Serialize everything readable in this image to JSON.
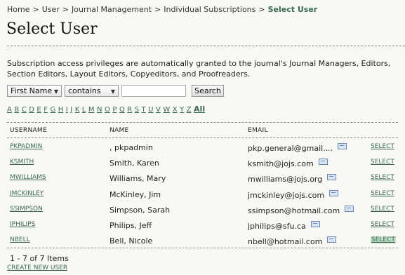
{
  "breadcrumb": {
    "home": "Home",
    "user": "User",
    "journal_management": "Journal Management",
    "individual_subscriptions": "Individual Subscriptions",
    "current": "Select User",
    "separator": ">"
  },
  "page_title": "Select User",
  "intro": "Subscription access privileges are automatically granted to the journal's Journal Managers, Editors, Section Editors, Layout Editors, Copyeditors, and Proofreaders.",
  "search": {
    "field_select": "First Name",
    "match_select": "contains",
    "query_value": "",
    "button": "Search"
  },
  "alphabet": [
    "A",
    "B",
    "C",
    "D",
    "E",
    "F",
    "G",
    "H",
    "I",
    "J",
    "K",
    "L",
    "M",
    "N",
    "O",
    "P",
    "Q",
    "R",
    "S",
    "T",
    "U",
    "V",
    "W",
    "X",
    "Y",
    "Z"
  ],
  "alphabet_all": "All",
  "table": {
    "headers": {
      "username": "USERNAME",
      "name": "NAME",
      "email": "EMAIL"
    },
    "select_label": "SELECT",
    "rows": [
      {
        "username": "PKPADMIN",
        "name": ", pkpadmin",
        "email": "pkp.general@gmail...."
      },
      {
        "username": "KSMITH",
        "name": "Smith, Karen",
        "email": "ksmith@jojs.com"
      },
      {
        "username": "MWILLIAMS",
        "name": "Williams, Mary",
        "email": "mwilliams@jojs.org"
      },
      {
        "username": "JMCKINLEY",
        "name": "McKinley, Jim",
        "email": "jmckinley@jojs.com"
      },
      {
        "username": "SSIMPSON",
        "name": "Simpson, Sarah",
        "email": "ssimpson@hotmail.com"
      },
      {
        "username": "JPHILIPS",
        "name": "Philips, Jeff",
        "email": "jphilips@sfu.ca"
      },
      {
        "username": "NBELL",
        "name": "Bell, Nicole",
        "email": "nbell@hotmail.com"
      }
    ]
  },
  "count": "1 - 7 of 7 Items",
  "create_new_user": "CREATE NEW USER",
  "colors": {
    "link": "#3b6b4f",
    "background": "#f8f8f5",
    "active_highlight": "#c2dac8"
  }
}
